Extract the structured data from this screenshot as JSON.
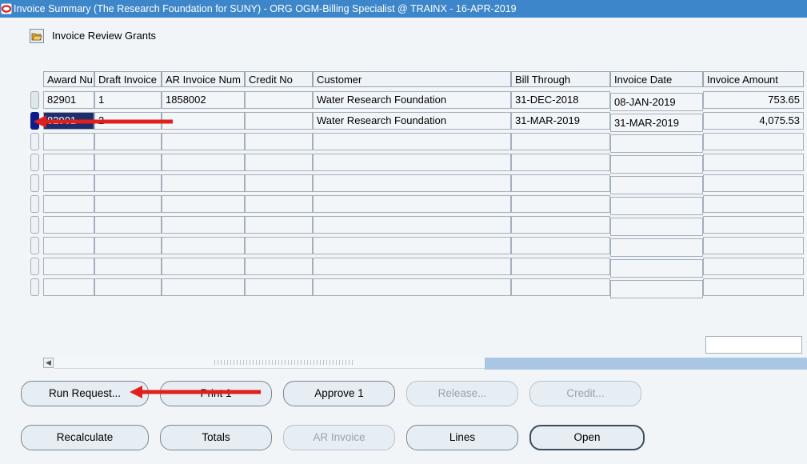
{
  "window": {
    "title": "Invoice Summary (The Research Foundation for SUNY) - ORG OGM-Billing Specialist @ TRAINX - 16-APR-2019",
    "icon": "oracle-logo-icon"
  },
  "form": {
    "folder_icon": "folder-open-icon",
    "folder_label": "Invoice Review Grants"
  },
  "table": {
    "headers": [
      "Award Nu",
      "Draft Invoice",
      "AR Invoice Num",
      "Credit No",
      "Customer",
      "Bill Through",
      "Invoice Date",
      "Invoice Amount"
    ],
    "rows": [
      {
        "award": "82901",
        "draft": "1",
        "ar_invoice": "1858002",
        "credit": "",
        "customer": "Water Research Foundation",
        "bill_through": "31-DEC-2018",
        "invoice_date": "08-JAN-2019",
        "amount": "753.65"
      },
      {
        "award": "82901",
        "draft": "2",
        "ar_invoice": "",
        "credit": "",
        "customer": "Water Research Foundation",
        "bill_through": "31-MAR-2019",
        "invoice_date": "31-MAR-2019",
        "amount": "4,075.53"
      }
    ]
  },
  "buttons": {
    "row1": [
      "Run Request...",
      "Print 1",
      "Approve 1",
      "Release...",
      "Credit..."
    ],
    "row2": [
      "Recalculate",
      "Totals",
      "AR Invoice",
      "Lines",
      "Open"
    ]
  },
  "annotation": {
    "arrow_color": "#e0201c"
  }
}
